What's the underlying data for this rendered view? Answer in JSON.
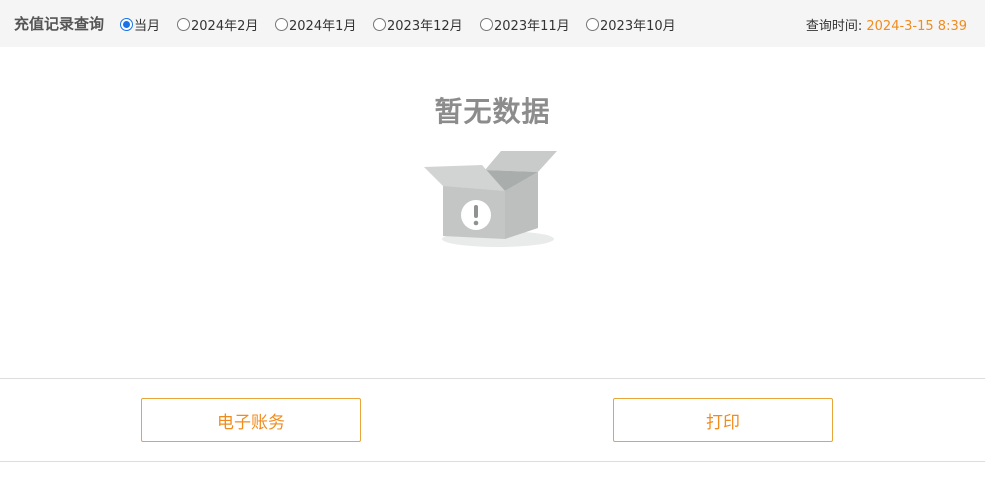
{
  "header": {
    "title": "充值记录查询",
    "period_options": [
      {
        "label": "当月",
        "selected": true
      },
      {
        "label": "2024年2月",
        "selected": false
      },
      {
        "label": "2024年1月",
        "selected": false
      },
      {
        "label": "2023年12月",
        "selected": false
      },
      {
        "label": "2023年11月",
        "selected": false
      },
      {
        "label": "2023年10月",
        "selected": false
      }
    ],
    "query_time_label": "查询时间:",
    "query_time_value": "2024-3-15 8:39"
  },
  "empty_state": {
    "title": "暂无数据",
    "icon": "open-box-exclamation-icon"
  },
  "actions": {
    "ebill_label": "电子账务",
    "print_label": "打印"
  },
  "colors": {
    "accent": "#f08c1e",
    "button_border": "#e8a53a",
    "radio_selected": "#1a73e8",
    "header_bg": "#f5f5f5"
  }
}
